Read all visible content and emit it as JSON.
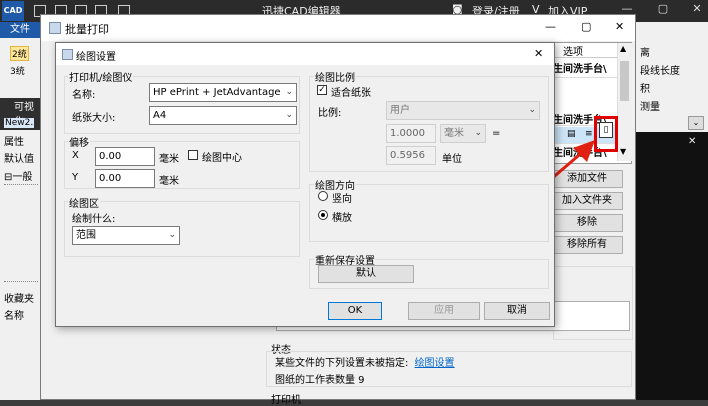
{
  "app": {
    "logo": "CAD",
    "title": "迅捷CAD编辑器",
    "login": "登录/注册",
    "vip": "加入VIP",
    "left": {
      "file_tab": "文件",
      "btn1": "2统",
      "btn2": "3统",
      "view_label": "可视化",
      "doc_tab": "New2.",
      "prop_title": "属性",
      "default_value": "默认值",
      "general": "一般",
      "fav_tab": "收藏夹",
      "name_label": "名称"
    },
    "ribbon": {
      "item1": "离",
      "item2": "段线长度",
      "item3": "积",
      "item4": "测量"
    }
  },
  "batch": {
    "title": "批量打印",
    "table": {
      "col_options": "选项",
      "row1": "生间洗手台\\",
      "row2": "生间洗手台\\",
      "row3": "生间洗手台\\"
    },
    "buttons": {
      "add_file": "添加文件",
      "add_folder": "加入文件夹",
      "remove": "移除",
      "remove_all": "移除所有"
    },
    "status": {
      "title": "状态",
      "line1": "某些文件的下列设置未被指定:",
      "link": "绘图设置",
      "line2": "图纸的工作表数量 9"
    },
    "printer_section": "打印机"
  },
  "dialog": {
    "title": "绘图设置",
    "printer_group": "打印机/绘图仪",
    "name_label": "名称:",
    "printer_value": "HP ePrint + JetAdvantage",
    "paper_label": "纸张大小:",
    "paper_value": "A4",
    "offset_group": "偏移",
    "x_label": "X",
    "x_value": "0.00",
    "x_unit": "毫米",
    "center_label": "绘图中心",
    "y_label": "Y",
    "y_value": "0.00",
    "y_unit": "毫米",
    "area_group": "绘图区",
    "what_label": "绘制什么:",
    "area_value": "范围",
    "scale_group": "绘图比例",
    "fit_label": "适合纸张",
    "ratio_label": "比例:",
    "ratio_value": "用户",
    "ratio_num": "1.0000",
    "ratio_unit": "毫米",
    "equals": "=",
    "ratio_denom": "0.5956",
    "unit_label": "单位",
    "orient_group": "绘图方向",
    "portrait": "竖向",
    "landscape": "横放",
    "reset_group": "重新保存设置",
    "default_btn": "默认",
    "ok": "OK",
    "apply": "应用",
    "cancel": "取消"
  },
  "colors": {
    "highlight": "#e00000",
    "arrow": "#e02010",
    "selection": "#cce4f7"
  }
}
